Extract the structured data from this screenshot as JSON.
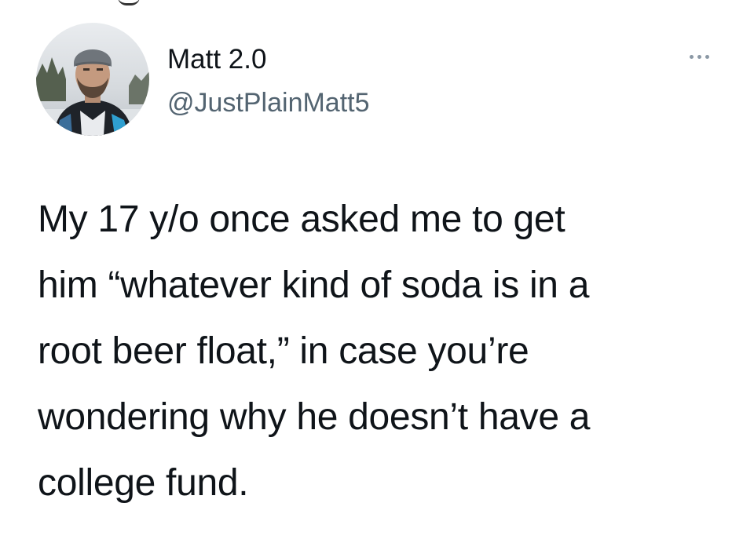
{
  "tweet": {
    "author": {
      "display_name": "Matt 2.0",
      "handle": "@JustPlainMatt5",
      "avatar_icon": "user-avatar-photo"
    },
    "more_icon": "more-options-icon",
    "text_lines": [
      "My 17 y/o once asked me to get",
      "him “whatever kind of soda is in a",
      "root beer float,” in case you’re",
      "wondering why he doesn’t have a",
      "college fund."
    ]
  },
  "colors": {
    "background": "#ffffff",
    "text": "#0f1419",
    "handle": "#536471",
    "more_dots": "#8b98a5"
  }
}
